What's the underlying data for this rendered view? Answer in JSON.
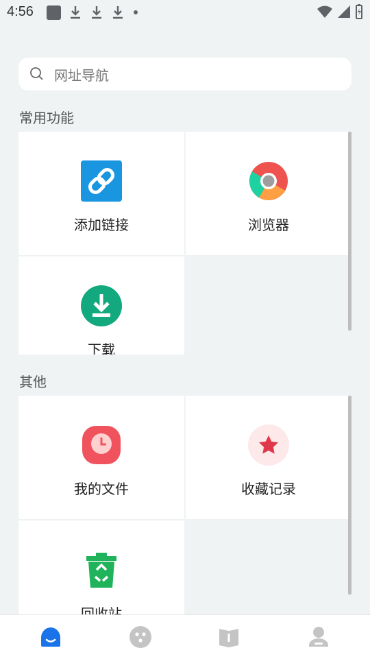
{
  "status_bar": {
    "time": "4:56"
  },
  "search": {
    "placeholder": "网址导航"
  },
  "sections": [
    {
      "title": "常用功能",
      "items": [
        {
          "label": "添加链接",
          "icon": "link-icon",
          "color": "#1a96e0"
        },
        {
          "label": "浏览器",
          "icon": "chrome-browser-icon"
        },
        {
          "label": "下载",
          "icon": "download-icon",
          "color": "#13a97f"
        }
      ]
    },
    {
      "title": "其他",
      "items": [
        {
          "label": "我的文件",
          "icon": "clock-file-icon",
          "color": "#f0535d"
        },
        {
          "label": "收藏记录",
          "icon": "star-icon",
          "color": "#e0384b"
        },
        {
          "label": "回收站",
          "icon": "recycle-bin-icon",
          "color": "#21b35b"
        }
      ]
    }
  ],
  "bottom_nav": {
    "active_color": "#1a73e8",
    "items": [
      "home-icon",
      "discover-icon",
      "book-icon",
      "profile-icon"
    ]
  }
}
